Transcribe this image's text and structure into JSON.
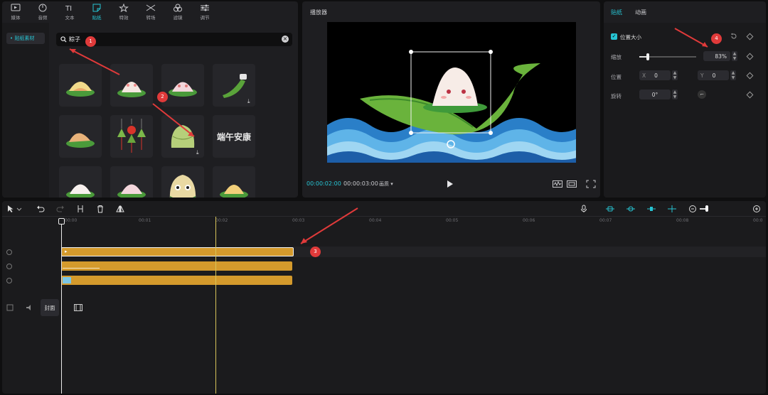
{
  "toolbar": {
    "tools": [
      {
        "label": "媒体",
        "icon": "media-icon"
      },
      {
        "label": "音频",
        "icon": "audio-icon"
      },
      {
        "label": "文本",
        "icon": "text-icon"
      },
      {
        "label": "贴纸",
        "icon": "sticker-icon",
        "active": true
      },
      {
        "label": "特效",
        "icon": "effects-icon"
      },
      {
        "label": "转场",
        "icon": "transition-icon"
      },
      {
        "label": "滤镜",
        "icon": "filter-icon"
      },
      {
        "label": "调节",
        "icon": "adjust-icon"
      }
    ]
  },
  "sticker_panel": {
    "category": "• 贴纸素材",
    "search_value": "粽子",
    "grid_text_sticker": "端午安康"
  },
  "annotations": [
    "1",
    "2",
    "3",
    "4"
  ],
  "player": {
    "title": "播放器",
    "current_time": "00:00:02:00",
    "total_time": "00:00:03:00",
    "quality": "画质 ▾"
  },
  "props": {
    "tabs": [
      "贴纸",
      "动画"
    ],
    "uniform_scale_label": "位置大小",
    "scale_label": "缩放",
    "scale_value": "83%",
    "scale_fraction": 0.15,
    "position_label": "位置",
    "x_label": "X",
    "x_value": "0",
    "y_label": "Y",
    "y_value": "0",
    "rotation_label": "旋转",
    "rotation_value": "0°"
  },
  "timeline": {
    "ticks": [
      "00:00",
      "00:01",
      "00:02",
      "00:03",
      "00:04",
      "00:05",
      "00:06",
      "00:07",
      "00:08",
      "00:0"
    ],
    "cover_label": "封面"
  },
  "colors": {
    "accent": "#27c4d3",
    "clip": "#d49a2c",
    "annotation": "#e03a3a"
  }
}
